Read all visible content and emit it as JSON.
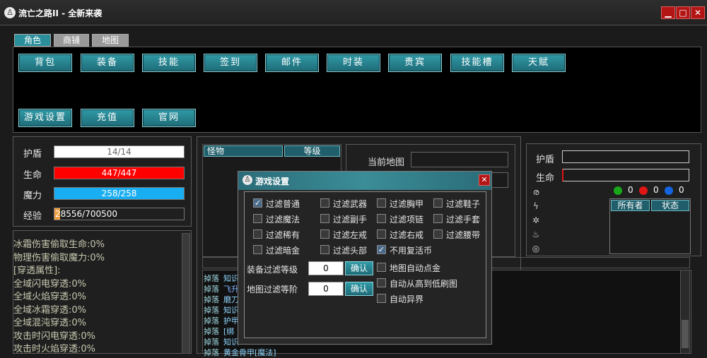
{
  "window": {
    "title": "流亡之路II - 全新来袭",
    "icon_glyph": "♙",
    "minimize_glyph": "▁",
    "maximize_glyph": "□",
    "close_glyph": "✕"
  },
  "tabs": [
    "角色",
    "商铺",
    "地图"
  ],
  "menu_buttons_row1": [
    "背包",
    "装备",
    "技能",
    "签到",
    "邮件",
    "时装",
    "贵宾",
    "技能槽",
    "天赋"
  ],
  "menu_buttons_row2": [
    "游戏设置",
    "充值",
    "官网"
  ],
  "stats": {
    "shield": {
      "label": "护盾",
      "text": "14/14",
      "fraction": 1.0,
      "color": "#ffffff"
    },
    "hp": {
      "label": "生命",
      "text": "447/447",
      "fraction": 1.0,
      "color": "#ff0000"
    },
    "mp": {
      "label": "魔力",
      "text": "258/258",
      "fraction": 1.0,
      "color": "#19aef2"
    },
    "exp": {
      "label": "经验",
      "text": "28556/700500",
      "fraction": 0.041,
      "color": "#f0a040"
    }
  },
  "attributes": [
    "冰霜伤害偷取生命:0%",
    "物理伤害偷取魔力:0%",
    "[穿透属性]:",
    "全域闪电穿透:0%",
    "全域火焰穿透:0%",
    "全域冰霜穿透:0%",
    "全域混沌穿透:0%",
    "攻击时闪电穿透:0%",
    "攻击时火焰穿透:0%"
  ],
  "monster_table": {
    "headers": [
      "怪物",
      "等级"
    ]
  },
  "current_map": {
    "label": "当前地图"
  },
  "drop_log": [
    {
      "prefix": "掉落",
      "text": "知识",
      "color": "#8fd6ff"
    },
    {
      "prefix": "掉落",
      "text": "飞升",
      "color": "#7fb3ff"
    },
    {
      "prefix": "掉落",
      "text": "磨刀",
      "color": "#8fd6ff"
    },
    {
      "prefix": "掉落",
      "text": "知识",
      "color": "#8fd6ff"
    },
    {
      "prefix": "掉落",
      "text": "护甲",
      "color": "#8fd6ff"
    },
    {
      "prefix": "掉落",
      "text": "[绑",
      "color": "#8fd6ff"
    },
    {
      "prefix": "掉落",
      "text": "知识",
      "color": "#8fd6ff"
    },
    {
      "prefix": "掉落",
      "text": "黄金骨甲[魔法]",
      "color": "#8fd6ff"
    }
  ],
  "enemy_panel": {
    "shield_label": "护盾",
    "hp_label": "生命",
    "counters": [
      {
        "color": "#1aa81a",
        "value": "0"
      },
      {
        "color": "#e01515",
        "value": "0"
      },
      {
        "color": "#1565e0",
        "value": "0"
      }
    ],
    "table_headers": [
      "所有者",
      "状态"
    ],
    "icons": [
      "swirl-icon",
      "lightning-icon",
      "snowflake-icon",
      "flame-icon",
      "spiral-icon"
    ],
    "icon_glyphs": [
      "ര",
      "ϟ",
      "✲",
      "♨",
      "◎"
    ]
  },
  "dialog": {
    "title": "游戏设置",
    "icon_glyph": "♙",
    "close_glyph": "✕",
    "checkboxes": [
      {
        "label": "过滤普通",
        "checked": true
      },
      {
        "label": "过滤武器",
        "checked": false
      },
      {
        "label": "过滤胸甲",
        "checked": false
      },
      {
        "label": "过滤鞋子",
        "checked": false
      },
      {
        "label": "过滤魔法",
        "checked": false
      },
      {
        "label": "过滤副手",
        "checked": false
      },
      {
        "label": "过滤项链",
        "checked": false
      },
      {
        "label": "过滤手套",
        "checked": false
      },
      {
        "label": "过滤稀有",
        "checked": false
      },
      {
        "label": "过滤左戒",
        "checked": false
      },
      {
        "label": "过滤右戒",
        "checked": false
      },
      {
        "label": "过滤腰带",
        "checked": false
      },
      {
        "label": "过滤暗金",
        "checked": false
      },
      {
        "label": "过滤头部",
        "checked": false
      },
      {
        "label": "不用复活币",
        "checked": true
      }
    ],
    "equip_level": {
      "label": "装备过滤等级",
      "value": "0",
      "button": "确认"
    },
    "map_level": {
      "label": "地图过滤等阶",
      "value": "0",
      "button": "确认"
    },
    "right_options": [
      {
        "label": "地图自动点金",
        "checked": false
      },
      {
        "label": "自动从高到低刷图",
        "checked": false
      },
      {
        "label": "自动异界",
        "checked": false
      }
    ]
  }
}
